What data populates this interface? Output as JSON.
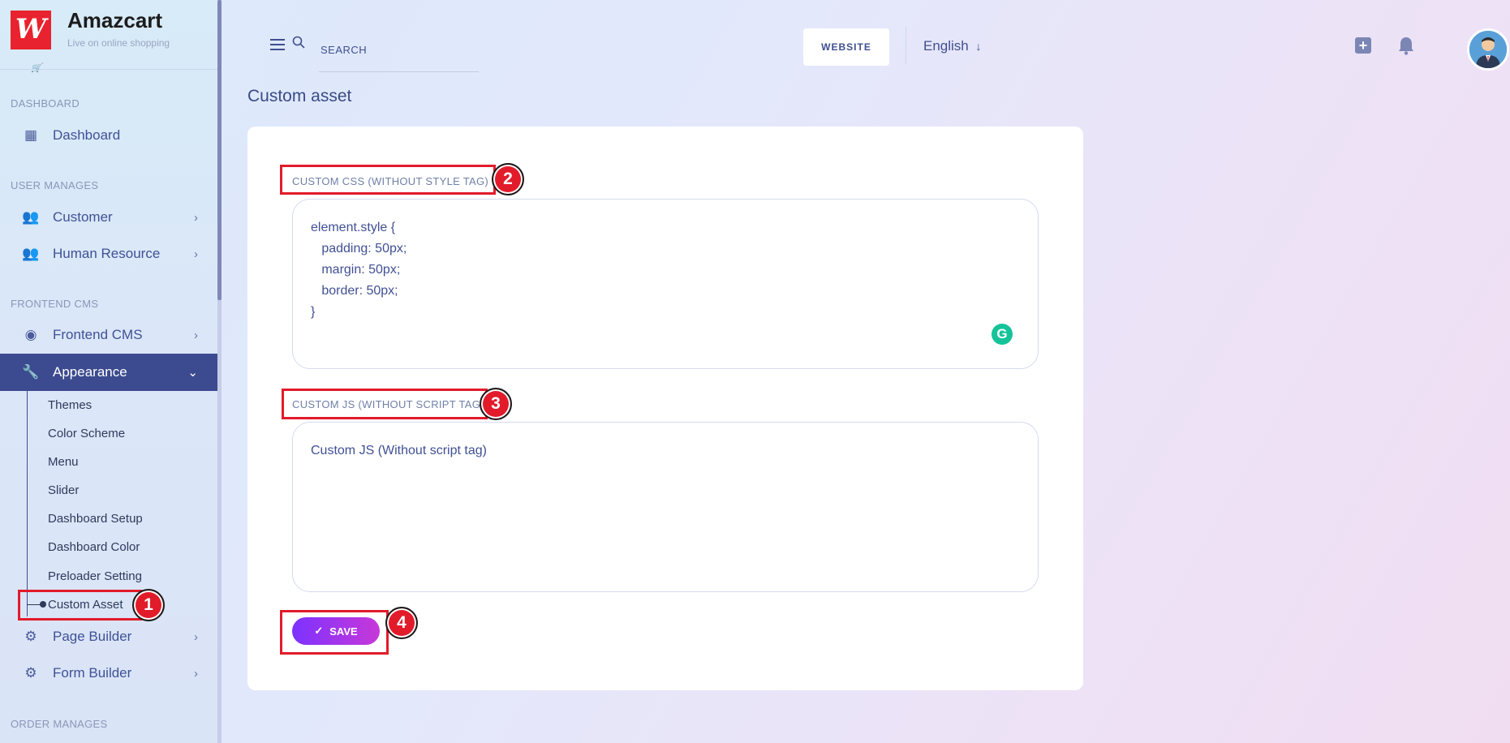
{
  "brand": {
    "name": "Amazcart",
    "tagline": "Live on online shopping"
  },
  "sidebar": {
    "sections": {
      "dashboard": "DASHBOARD",
      "user_manages": "USER MANAGES",
      "frontend_cms": "FRONTEND CMS",
      "order_manages": "ORDER MANAGES"
    },
    "items": {
      "dashboard": "Dashboard",
      "customer": "Customer",
      "human_resource": "Human Resource",
      "frontend_cms": "Frontend CMS",
      "appearance": "Appearance",
      "page_builder": "Page Builder",
      "form_builder": "Form Builder"
    },
    "appearance_sub": [
      "Themes",
      "Color Scheme",
      "Menu",
      "Slider",
      "Dashboard Setup",
      "Dashboard Color",
      "Preloader Setting",
      "Custom Asset"
    ]
  },
  "header": {
    "search_placeholder": "SEARCH",
    "website_button": "WEBSITE",
    "language": "English"
  },
  "page": {
    "title": "Custom asset",
    "css_label": "CUSTOM CSS (WITHOUT STYLE TAG)",
    "css_value": "element.style {\n   padding: 50px;\n   margin: 50px;\n   border: 50px;\n}",
    "js_label": "CUSTOM JS (WITHOUT SCRIPT TAG)",
    "js_placeholder": "Custom JS (Without script tag)",
    "save_label": "SAVE"
  },
  "annotations": [
    "1",
    "2",
    "3",
    "4"
  ],
  "colors": {
    "accent": "#3c4b8f",
    "annotation": "#e21b2a",
    "save_start": "#7c32ff",
    "save_end": "#c738d8"
  }
}
